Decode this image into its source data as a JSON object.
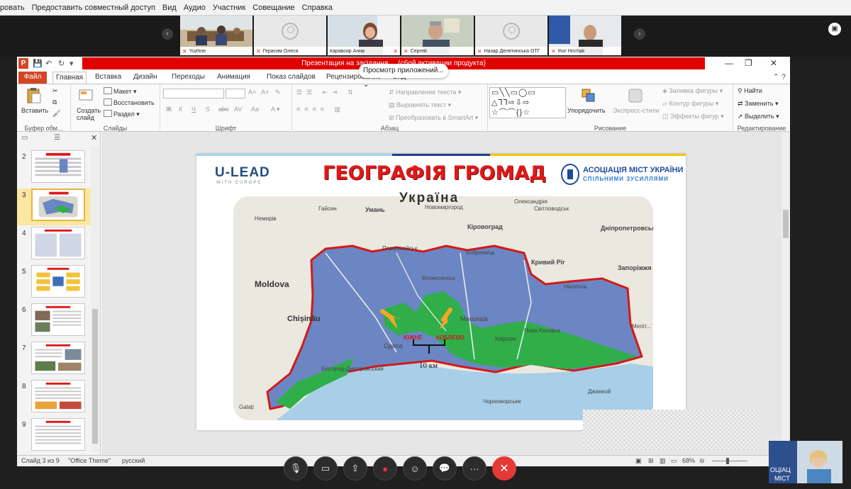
{
  "zoom_menu": [
    "ровать",
    "Предоставить совместный доступ",
    "Вид",
    "Аудио",
    "Участник",
    "Совещание",
    "Справка"
  ],
  "gallery": {
    "participants": [
      {
        "name": "Yuzhne",
        "mic_muted": true,
        "active": true
      },
      {
        "name": "Герасим Олеся",
        "mic_muted": true
      },
      {
        "name": "Каравсир Анна",
        "mic_muted": true
      },
      {
        "name": "Сергей",
        "mic_muted": true
      },
      {
        "name": "Назар Делятинська ОТГ",
        "mic_muted": true
      },
      {
        "name": "Ihor Hirchak",
        "mic_muted": true
      }
    ]
  },
  "ppt": {
    "banner": "Презентация на засідання ... (сбой активации продукта)",
    "share_pill": "Просмотр приложений...",
    "tabs": {
      "file": "Файл",
      "home": "Главная",
      "insert": "Вставка",
      "design": "Дизайн",
      "transitions": "Переходы",
      "animation": "Анимация",
      "slideshow": "Показ слайдов",
      "review": "Рецензирование",
      "view": "Вид"
    },
    "ribbon": {
      "clipboard": {
        "paste": "Вставить",
        "label": "Буфер обм..."
      },
      "slides": {
        "new_slide": "Создать слайд",
        "layout": "Макет",
        "reset": "Восстановить",
        "section": "Раздел",
        "label": "Слайды"
      },
      "font": {
        "label": "Шрифт",
        "bold": "Ж",
        "italic": "К",
        "underline": "Ч",
        "strike": "S",
        "spacing": "abc",
        "case": "Аа"
      },
      "paragraph": {
        "text_direction": "Направление текста",
        "align_text": "Выровнять текст",
        "smartart": "Преобразовать в SmartArt",
        "label": "Абзац"
      },
      "drawing": {
        "arrange": "Упорядочить",
        "quick_styles": "Экспресс-стили",
        "fill": "Заливка фигуры",
        "outline": "Контур фигуры",
        "effects": "Эффекты фигур",
        "label": "Рисование"
      },
      "editing": {
        "find": "Найти",
        "replace": "Заменить",
        "select": "Выделить",
        "label": "Редактирование"
      }
    },
    "slide_numbers": [
      "2",
      "3",
      "4",
      "5",
      "6",
      "7",
      "8",
      "9"
    ],
    "selected_slide": "3",
    "status": {
      "slide": "Слайд 3 из 9",
      "theme": "\"Office Theme\"",
      "lang": "русский",
      "zoom": "68%"
    }
  },
  "slide": {
    "logo_left": "U-LEAD",
    "logo_left_sub": "WITH EUROPE",
    "title": "ГЕОГРАФІЯ ГРОМАД",
    "assoc_line1": "АСОЦІАЦІЯ МІСТ УКРАЇНИ",
    "assoc_line2": "СПІЛЬНИМИ ЗУСИЛЛЯМИ",
    "map_title": "Україна",
    "map_labels": {
      "yuzhne": "ЮЖНЕ",
      "koblevo": "КОБЛЕВО",
      "distance": "10 км",
      "moldova": "Moldova",
      "chisinau": "Chișinău",
      "odesa": "Одеса",
      "mykolaiv": "Миколаїв",
      "kherson": "Херсон",
      "kryvyi_rih": "Кривий Ріг",
      "zaporizhzhia": "Запоріжжя",
      "dnipropetrovsk": "Дніпропетровськ",
      "kirovohrad": "Кіровоград",
      "uman": "Умань",
      "belgorod": "Білгород-Дністровський",
      "nova_kakhovka": "Нова Каховка",
      "melitopol": "Меліт...",
      "nikopol": "Нікополь",
      "novomyrhorod": "Новомиргород",
      "oleksandriia": "Олександрія",
      "pervomaisk": "Первомайськ",
      "voznesensk": "Вознесенськ",
      "svitlovodsk": "Світловодськ",
      "nemyriv": "Немирів",
      "haisyn": "Гайсин",
      "bobrynets": "Бобринець",
      "halati": "Galați",
      "chornomorske": "Чорноморське",
      "dzhankoi": "Джанкой"
    },
    "colors": {
      "title": "#e11818",
      "region_fill": "#6b86c3",
      "community_fill": "#2fae4a",
      "border": "#d21a1a",
      "arrow": "#f5a623"
    }
  },
  "meeting_toolbar": [
    "mic-off-icon",
    "video-off-icon",
    "share-screen-icon",
    "record-icon",
    "participants-icon",
    "chat-icon",
    "more-icon",
    "end-call-icon"
  ]
}
